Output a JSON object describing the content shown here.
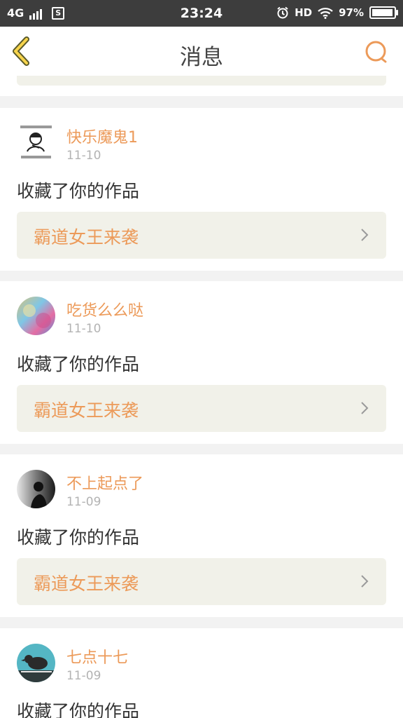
{
  "status_bar": {
    "network": "4G",
    "sim_badge": "S",
    "time": "23:24",
    "hd": "HD",
    "battery": "97%",
    "battery_level": 0.97
  },
  "header": {
    "title": "消息",
    "accent_color": "#ec9a59"
  },
  "messages": [
    {
      "username": "快乐魔鬼1",
      "date": "11-10",
      "action": "收藏了你的作品",
      "work_title": "霸道女王来袭",
      "avatar": "sketch-avatar"
    },
    {
      "username": "吃货么么哒",
      "date": "11-10",
      "action": "收藏了你的作品",
      "work_title": "霸道女王来袭",
      "avatar": "watercolor-avatar"
    },
    {
      "username": "不上起点了",
      "date": "11-09",
      "action": "收藏了你的作品",
      "work_title": "霸道女王来袭",
      "avatar": "dark-photo-avatar"
    },
    {
      "username": "七点十七",
      "date": "11-09",
      "action": "收藏了你的作品",
      "work_title": "",
      "avatar": "bird-avatar"
    }
  ]
}
